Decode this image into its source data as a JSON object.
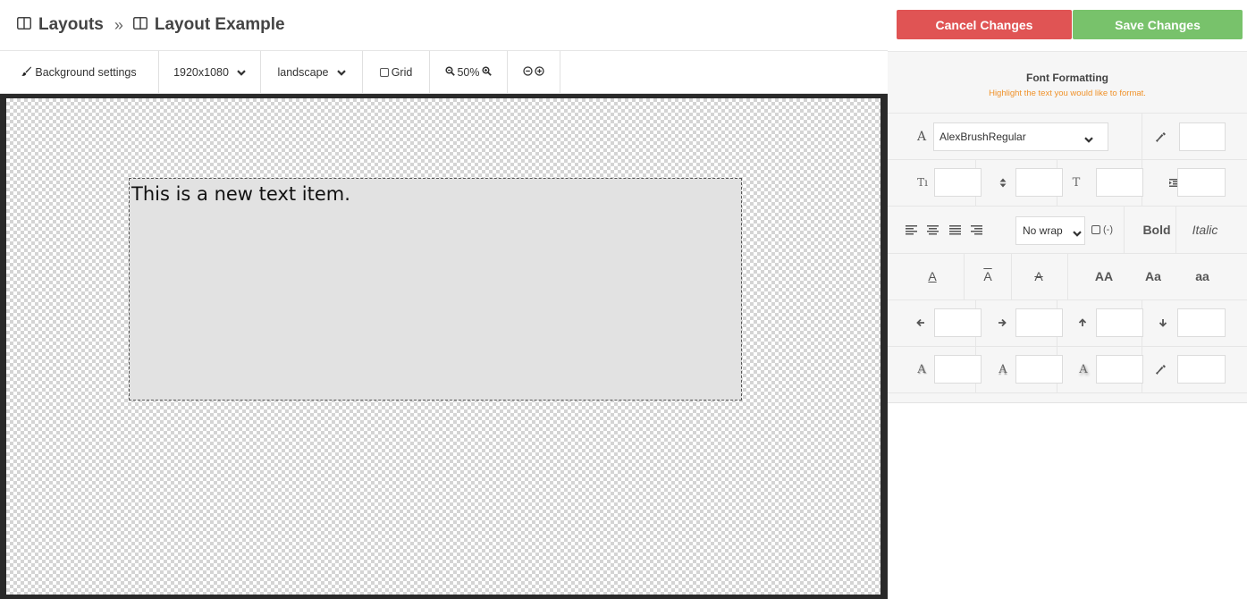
{
  "breadcrumb": {
    "root": "Layouts",
    "separator": "»",
    "current": "Layout Example"
  },
  "toolbar": {
    "background_settings": "Background settings",
    "resolution": "1920x1080",
    "orientation": "landscape",
    "grid": "Grid",
    "zoom": "50%"
  },
  "canvas": {
    "text_item": "This is a new text item."
  },
  "actions": {
    "cancel": "Cancel Changes",
    "save": "Save Changes"
  },
  "formatting": {
    "title": "Font Formatting",
    "subtitle": "Highlight the text you would like to format.",
    "font": "AlexBrushRegular",
    "wrap": "No wrap",
    "wrap_toggle": "(-)",
    "bold": "Bold",
    "italic": "Italic",
    "case_upper": "AA",
    "case_title": "Aa",
    "case_lower": "aa",
    "decoration_glyph": "A"
  },
  "colors": {
    "cancel": "#e05454",
    "save": "#78c26b",
    "hint": "#f0922a",
    "panel_bg": "#f6f6f6",
    "canvas_frame": "#2a2a2a",
    "text_item_bg": "#e2e2e2"
  }
}
